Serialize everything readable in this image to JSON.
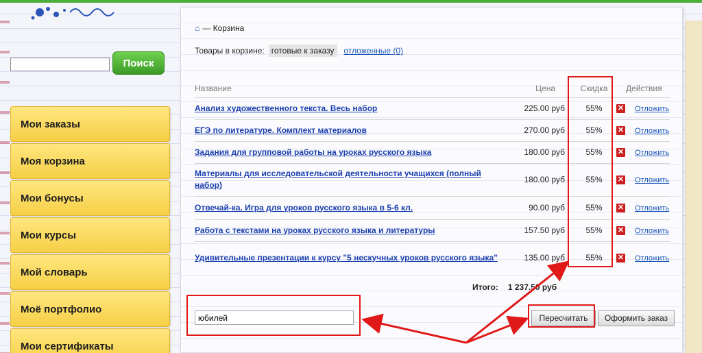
{
  "search": {
    "value": "",
    "button_label": "Поиск"
  },
  "sidebar": {
    "items": [
      {
        "label": "Мои заказы"
      },
      {
        "label": "Моя корзина"
      },
      {
        "label": "Мои бонусы"
      },
      {
        "label": "Мои курсы"
      },
      {
        "label": "Мой словарь"
      },
      {
        "label": "Моё портфолио"
      },
      {
        "label": "Мои сертификаты"
      }
    ]
  },
  "breadcrumb": {
    "home_icon": "home-icon",
    "separator": "—",
    "current": "Корзина"
  },
  "cart_tabs": {
    "label": "Товары в корзине:",
    "active": "готовые к заказу",
    "deferred": "отложенные (0)"
  },
  "table": {
    "headers": {
      "name": "Название",
      "price": "Цена",
      "discount": "Скидка",
      "actions": "Действия"
    },
    "rows": [
      {
        "name": "Анализ художественного текста. Весь набор",
        "price": "225.00 руб",
        "discount": "55%",
        "action": "Отложить"
      },
      {
        "name": "ЕГЭ по литературе. Комплект материалов",
        "price": "270.00 руб",
        "discount": "55%",
        "action": "Отложить"
      },
      {
        "name": "Задания для групповой работы на уроках русского языка",
        "price": "180.00 руб",
        "discount": "55%",
        "action": "Отложить"
      },
      {
        "name": "Материалы для исследовательской деятельности учащихся (полный набор)",
        "price": "180.00 руб",
        "discount": "55%",
        "action": "Отложить"
      },
      {
        "name": "Отвечай-ка. Игра для уроков русского языка в 5-6 кл.",
        "price": "90.00 руб",
        "discount": "55%",
        "action": "Отложить"
      },
      {
        "name": "Работа с текстами на уроках русского языка и литературы",
        "price": "157.50 руб",
        "discount": "55%",
        "action": "Отложить"
      },
      {
        "name": "Удивительные презентации к курсу \"5 нескучных уроков русского языка\"",
        "price": "135.00 руб",
        "discount": "55%",
        "action": "Отложить"
      }
    ]
  },
  "total": {
    "label": "Итого:",
    "value": "1 237.50 руб"
  },
  "promo": {
    "value": "юбилей"
  },
  "buttons": {
    "recalculate": "Пересчитать",
    "checkout": "Оформить заказ"
  },
  "colors": {
    "highlight": "#e01818",
    "menu": "#f6cf45",
    "search_button": "#3c9a25",
    "link": "#1a3fae"
  }
}
